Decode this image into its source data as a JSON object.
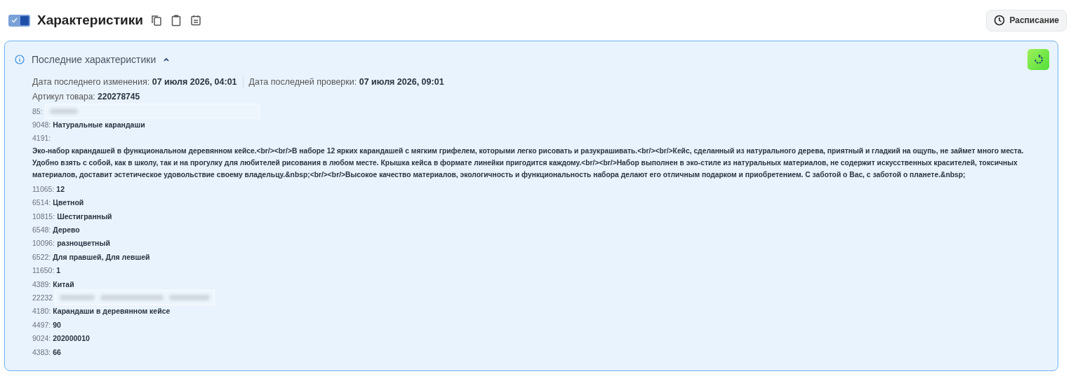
{
  "header": {
    "toggle": {
      "on": true
    },
    "title": "Характеристики",
    "schedule_button": "Расписание"
  },
  "panel": {
    "title": "Последние характеристики",
    "expanded": true,
    "dates": [
      {
        "label": "Дата последнего изменения:",
        "value": "07 июля 2026, 04:01"
      },
      {
        "label": "Дата последней проверки:",
        "value": "07 июля 2026, 09:01"
      }
    ],
    "article": {
      "label": "Артикул товара:",
      "value": "220278745"
    },
    "rows": [
      {
        "kind": "redacted",
        "label": "85:"
      },
      {
        "kind": "text",
        "label": "9048:",
        "value": "Натуральные карандаши"
      },
      {
        "kind": "long",
        "label": "4191:",
        "value": "Эко-набор карандашей в функциональном деревянном кейсе.<br/><br/>В наборе 12 ярких карандашей с мягким грифелем, которыми легко рисовать и разукрашивать.<br/><br/>Кейс, сделанный из натурального дерева, приятный и гладкий на ощупь, не займет много места. Удобно взять с собой, как в школу, так и на прогулку для любителей рисования в любом месте. Крышка кейса в формате линейки пригодится каждому.<br/><br/>Набор выполнен в эко-стиле из натуральных материалов, не содержит искусственных красителей, токсичных материалов, доставит эстетическое удовольствие своему владельцу.&nbsp;<br/><br/>Высокое качество материалов, экологичность и функциональность набора делают его отличным подарком и приобретением. С заботой о Вас, с заботой о планете.&nbsp;"
      },
      {
        "kind": "text",
        "label": "11065:",
        "value": "12"
      },
      {
        "kind": "text",
        "label": "6514:",
        "value": "Цветной"
      },
      {
        "kind": "text",
        "label": "10815:",
        "value": "Шестигранный"
      },
      {
        "kind": "text",
        "label": "6548:",
        "value": "Дерево"
      },
      {
        "kind": "text",
        "label": "10096:",
        "value": "разноцветный"
      },
      {
        "kind": "text",
        "label": "6522:",
        "value": "Для правшей, Для левшей"
      },
      {
        "kind": "text",
        "label": "11650:",
        "value": "1"
      },
      {
        "kind": "text",
        "label": "4389:",
        "value": "Китай"
      },
      {
        "kind": "redacted",
        "label": "22232"
      },
      {
        "kind": "text",
        "label": "4180:",
        "value": "Карандаши в деревянном кейсе"
      },
      {
        "kind": "text",
        "label": "4497:",
        "value": "90"
      },
      {
        "kind": "text",
        "label": "9024:",
        "value": "202000010"
      },
      {
        "kind": "text",
        "label": "4383:",
        "value": "66"
      }
    ]
  }
}
